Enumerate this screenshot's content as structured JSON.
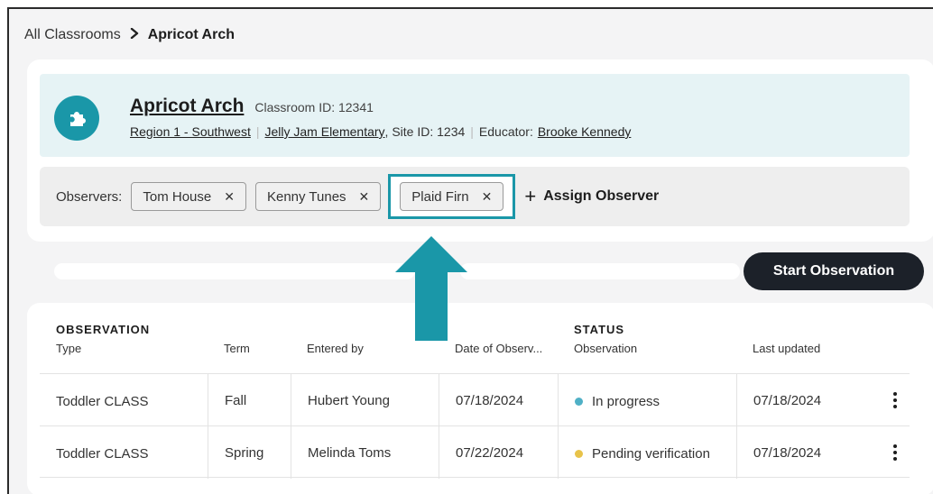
{
  "breadcrumb": {
    "parent": "All Classrooms",
    "separator": "›",
    "current": "Apricot Arch"
  },
  "classroom": {
    "name": "Apricot Arch",
    "id_label": "Classroom ID: 12341",
    "region": "Region 1 - Southwest",
    "school": "Jelly Jam Elementary",
    "site": ", Site ID: 1234",
    "educator_label": "Educator:",
    "educator": "Brooke Kennedy",
    "icon": "puzzle-icon"
  },
  "observers": {
    "label": "Observers:",
    "chips": [
      "Tom House",
      "Kenny Tunes",
      "Plaid Firn"
    ],
    "remove_glyph": "✕",
    "assign_label": "Assign Observer",
    "assign_glyph": "+"
  },
  "actions": {
    "start_observation": "Start Observation"
  },
  "table": {
    "group_observation": "OBSERVATION",
    "group_status": "STATUS",
    "columns": {
      "type": "Type",
      "term": "Term",
      "entered_by": "Entered by",
      "date": "Date of Observ...",
      "status": "Observation",
      "updated": "Last updated"
    },
    "rows": [
      {
        "type": "Toddler CLASS",
        "term": "Fall",
        "entered_by": "Hubert Young",
        "date": "07/18/2024",
        "status": "In progress",
        "updated": "07/18/2024"
      },
      {
        "type": "Toddler CLASS",
        "term": "Spring",
        "entered_by": "Melinda Toms",
        "date": "07/22/2024",
        "status": "Pending verification",
        "updated": "07/18/2024"
      }
    ]
  },
  "colors": {
    "accent": "#1a97a8",
    "in_progress": "#4fb0c6",
    "pending": "#e8c34a",
    "button_dark": "#1c2129"
  }
}
